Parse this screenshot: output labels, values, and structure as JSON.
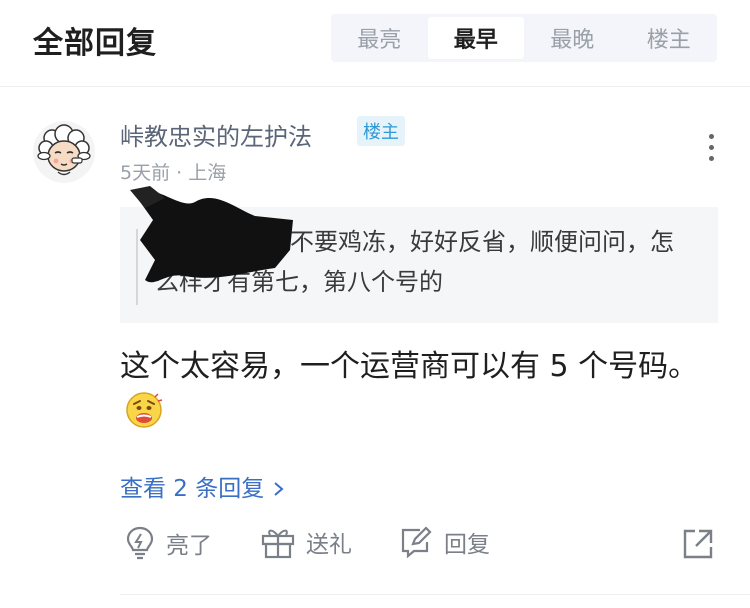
{
  "header": {
    "title": "全部回复",
    "sort_tabs": [
      {
        "label": "最亮",
        "active": false
      },
      {
        "label": "最早",
        "active": true
      },
      {
        "label": "最晚",
        "active": false
      },
      {
        "label": "楼主",
        "active": false
      }
    ]
  },
  "comment": {
    "username": "峠教忠实的左护法",
    "op_badge": "楼主",
    "meta": "5天前 · 上海",
    "quote_text": "不要鸡冻，好好反省，顺便问问，怎么样才有第七，第八个号的",
    "content": "这个太容易，一个运营商可以有 5 个号码。",
    "view_replies": "查看 2 条回复 ",
    "actions": {
      "like": "亮了",
      "gift": "送礼",
      "reply": "回复"
    }
  },
  "colors": {
    "accent_link": "#3a6fc4",
    "badge_text": "#2d9ad6",
    "muted": "#9aa0a8"
  }
}
